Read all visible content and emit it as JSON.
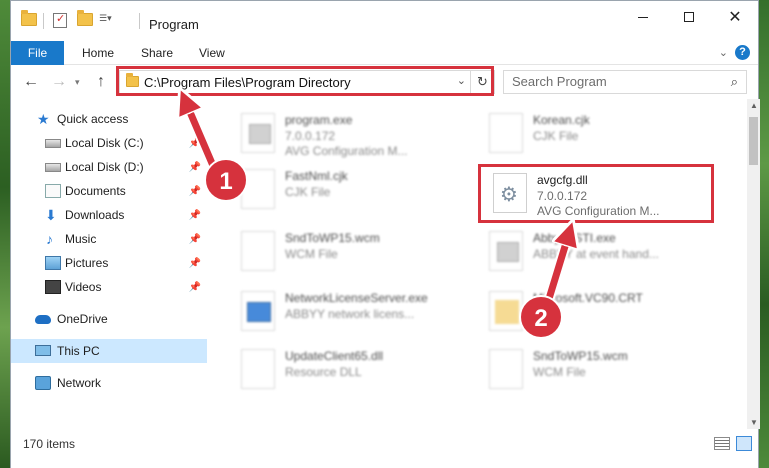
{
  "window": {
    "title": "Program",
    "minimize_icon": "minimize-icon",
    "maximize_icon": "maximize-icon",
    "close_glyph": "✕"
  },
  "ribbon": {
    "tabs": [
      {
        "label": "File"
      },
      {
        "label": "Home"
      },
      {
        "label": "Share"
      },
      {
        "label": "View"
      }
    ],
    "help_glyph": "?",
    "accent": "#1979ca"
  },
  "address": {
    "path": "C:\\Program Files\\Program Directory",
    "refresh_glyph": "↻"
  },
  "search": {
    "placeholder": "Search Program"
  },
  "nav_pane": {
    "items": [
      {
        "label": "Quick access"
      },
      {
        "label": "Local Disk (C:)"
      },
      {
        "label": "Local Disk (D:)"
      },
      {
        "label": "Documents"
      },
      {
        "label": "Downloads"
      },
      {
        "label": "Music"
      },
      {
        "label": "Pictures"
      },
      {
        "label": "Videos"
      },
      {
        "label": "OneDrive"
      },
      {
        "label": "This PC"
      },
      {
        "label": "Network"
      }
    ]
  },
  "files": [
    {
      "name": "program.exe",
      "line1": "7.0.0.172",
      "line2": "AVG Configuration M...",
      "icon": "exe-icon"
    },
    {
      "name": "Korean.cjk",
      "line1": "CJK File",
      "line2": "",
      "icon": "file-icon"
    },
    {
      "name": "FastNml.cjk",
      "line1": "CJK File",
      "line2": "",
      "icon": "file-icon"
    },
    {
      "name": "avgcfg.dll",
      "line1": "7.0.0.172",
      "line2": "AVG Configuration M...",
      "icon": "dll-gear-icon"
    },
    {
      "name": "SndToWP15.wcm",
      "line1": "WCM File",
      "line2": "",
      "icon": "file-icon"
    },
    {
      "name": "AbbyyASTI.exe",
      "line1": "ABBYY at event hand...",
      "line2": "",
      "icon": "exe-icon"
    },
    {
      "name": "NetworkLicenseServer.exe",
      "line1": "ABBYY network licens...",
      "line2": "",
      "icon": "app-icon"
    },
    {
      "name": "Microsoft.VC90.CRT",
      "line1": "",
      "line2": "",
      "icon": "folder-icon"
    },
    {
      "name": "UpdateClient65.dll",
      "line1": "Resource DLL",
      "line2": "",
      "icon": "file-icon"
    },
    {
      "name": "SndToWP15.wcm",
      "line1": "WCM File",
      "line2": "",
      "icon": "file-icon"
    }
  ],
  "status": {
    "item_count": "170 items"
  },
  "annotations": {
    "step1": "1",
    "step2": "2",
    "color": "#d6323d"
  }
}
